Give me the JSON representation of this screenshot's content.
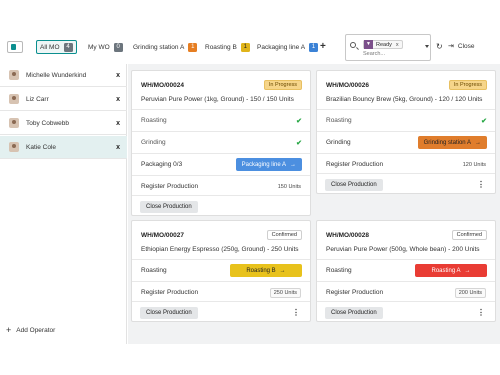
{
  "tabs": [
    {
      "label": "All MO",
      "count": "4"
    },
    {
      "label": "My WO",
      "count": "0"
    },
    {
      "label": "Grinding station A",
      "count": "1"
    },
    {
      "label": "Roasting B",
      "count": "1"
    },
    {
      "label": "Packaging line A",
      "count": "1"
    }
  ],
  "plus_label": "+",
  "search": {
    "facet_icon": "filter-icon",
    "facet_label": "Ready",
    "facet_remove": "x",
    "placeholder": "Search..."
  },
  "close_label": "Close",
  "operators": [
    {
      "name": "Michelle Wunderkind",
      "remove": "x"
    },
    {
      "name": "Liz Carr",
      "remove": "x"
    },
    {
      "name": "Toby Cobwebb",
      "remove": "x"
    },
    {
      "name": "Katie Cole",
      "remove": "x",
      "active": true
    }
  ],
  "add_operator": "Add Operator",
  "cards": [
    {
      "ref": "WH/MO/00024",
      "status": "In Progress",
      "product": "Peruvian Pure Power (1kg, Ground) - 150 / 150   Units",
      "steps": [
        {
          "label": "Roasting",
          "done": true
        },
        {
          "label": "Grinding",
          "done": true
        },
        {
          "label": "Packaging  0/3",
          "button": "Packaging line A"
        }
      ],
      "register": "Register Production",
      "register_qty": "150 Units",
      "close": "Close Production",
      "more": "⋮"
    },
    {
      "ref": "WH/MO/00026",
      "status": "In Progress",
      "product": "Brazilian Bouncy Brew (5kg, Ground) - 120 / 120   Units",
      "steps": [
        {
          "label": "Roasting",
          "done": true
        },
        {
          "label": "Grinding",
          "button": "Grinding station A"
        }
      ],
      "register": "Register Production",
      "register_qty": "120 Units",
      "close": "Close Production",
      "more": "⋮"
    },
    {
      "ref": "WH/MO/00027",
      "status": "Confirmed",
      "product": "Ethiopian Energy Espresso (250g, Ground) - 250    Units",
      "steps": [
        {
          "label": "Roasting",
          "button": "Roasting B"
        }
      ],
      "register": "Register Production",
      "register_qty": "250 Units",
      "close": "Close Production",
      "more": "⋮"
    },
    {
      "ref": "WH/MO/00028",
      "status": "Confirmed",
      "product": "Peruvian Pure Power (500g, Whole bean) - 200    Units",
      "steps": [
        {
          "label": "Roasting",
          "button": "Roasting A"
        }
      ],
      "register": "Register Production",
      "register_qty": "200 Units",
      "close": "Close Production",
      "more": "⋮"
    }
  ],
  "colors": {
    "accent": "#0b8f8f",
    "in_progress": "#f6d58a",
    "packaging_btn": "#4c8fe0",
    "grinding_btn": "#e07d2c",
    "roasting_b_btn": "#e8c21c",
    "roasting_a_btn": "#e93c34",
    "done_check": "#28a745"
  }
}
